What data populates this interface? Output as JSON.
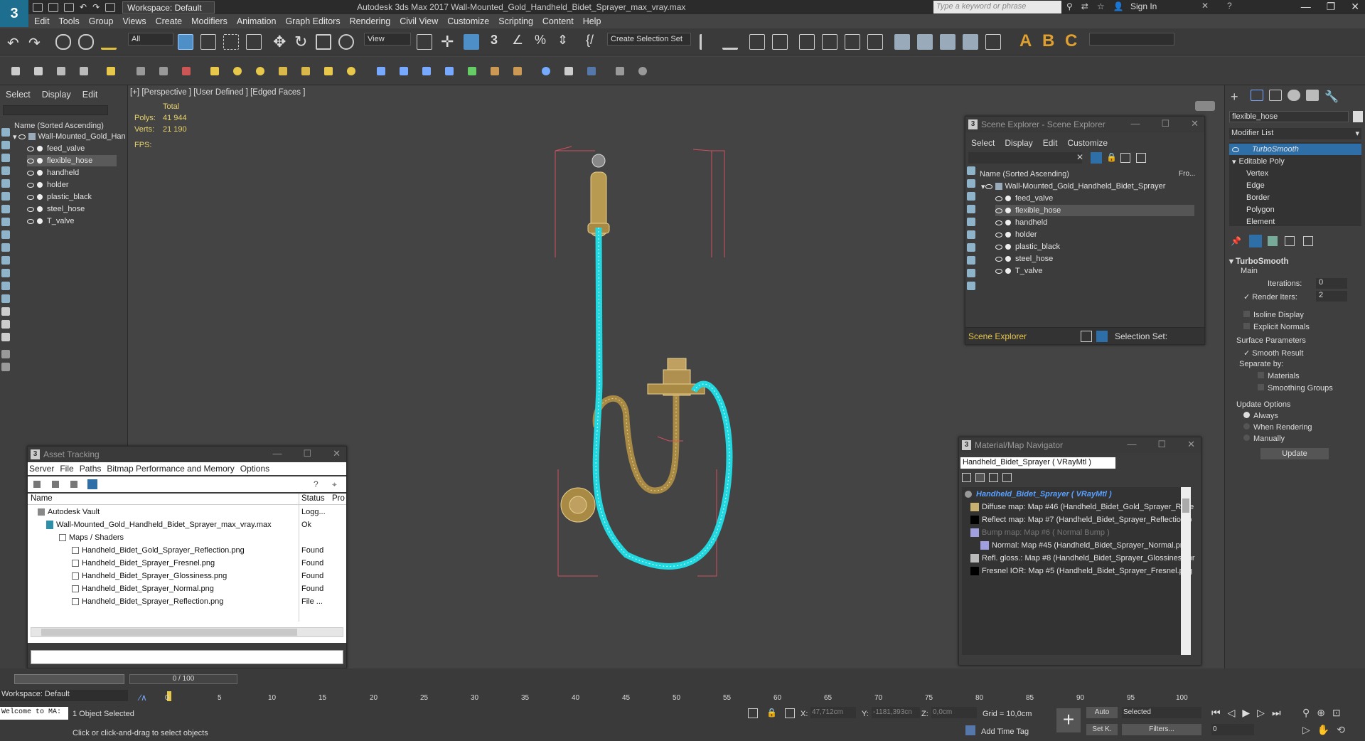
{
  "app": {
    "title": "Autodesk 3ds Max 2017     Wall-Mounted_Gold_Handheld_Bidet_Sprayer_max_vray.max",
    "logo": "3",
    "workspace": "Workspace: Default",
    "search_placeholder": "Type a keyword or phrase",
    "sign_in": "Sign In"
  },
  "menu": [
    "Edit",
    "Tools",
    "Group",
    "Views",
    "Create",
    "Modifiers",
    "Animation",
    "Graph Editors",
    "Rendering",
    "Civil View",
    "Customize",
    "Scripting",
    "Content",
    "Help"
  ],
  "toolbar": {
    "filter": "All",
    "view": "View",
    "selection_set": "Create Selection Set"
  },
  "left_panel": {
    "tabs": [
      "Select",
      "Display",
      "Edit"
    ],
    "header": "Name (Sorted Ascending)",
    "root": "Wall-Mounted_Gold_Han",
    "items": [
      "feed_valve",
      "flexible_hose",
      "handheld",
      "holder",
      "plastic_black",
      "steel_hose",
      "T_valve"
    ]
  },
  "viewport": {
    "labels": [
      "[+]",
      "[Perspective ]",
      "[User Defined ]",
      "[Edged Faces ]"
    ],
    "total": "Total",
    "polys_label": "Polys:",
    "polys": "41 944",
    "verts_label": "Verts:",
    "verts": "21 190",
    "fps": "FPS:"
  },
  "scene_explorer": {
    "title": "Scene Explorer - Scene Explorer",
    "menu": [
      "Select",
      "Display",
      "Edit",
      "Customize"
    ],
    "header": "Name (Sorted Ascending)",
    "header2": "Fro...",
    "root": "Wall-Mounted_Gold_Handheld_Bidet_Sprayer",
    "items": [
      "feed_valve",
      "flexible_hose",
      "handheld",
      "holder",
      "plastic_black",
      "steel_hose",
      "T_valve"
    ],
    "footer_label": "Scene Explorer",
    "selection_set": "Selection Set:"
  },
  "asset_tracking": {
    "title": "Asset Tracking",
    "menu": [
      "Server",
      "File",
      "Paths",
      "Bitmap Performance and Memory",
      "Options"
    ],
    "columns": [
      "Name",
      "Status",
      "Pro"
    ],
    "rows": [
      {
        "name": "Autodesk Vault",
        "status": "Logg..."
      },
      {
        "name": "Wall-Mounted_Gold_Handheld_Bidet_Sprayer_max_vray.max",
        "status": "Ok"
      },
      {
        "name": "Maps / Shaders",
        "status": ""
      },
      {
        "name": "Handheld_Bidet_Gold_Sprayer_Reflection.png",
        "status": "Found"
      },
      {
        "name": "Handheld_Bidet_Sprayer_Fresnel.png",
        "status": "Found"
      },
      {
        "name": "Handheld_Bidet_Sprayer_Glossiness.png",
        "status": "Found"
      },
      {
        "name": "Handheld_Bidet_Sprayer_Normal.png",
        "status": "Found"
      },
      {
        "name": "Handheld_Bidet_Sprayer_Reflection.png",
        "status": "File ..."
      }
    ]
  },
  "material_navigator": {
    "title": "Material/Map Navigator",
    "field": "Handheld_Bidet_Sprayer  ( VRayMtl )",
    "root": "Handheld_Bidet_Sprayer  ( VRayMtl )",
    "items": [
      "Diffuse map: Map #46 (Handheld_Bidet_Gold_Sprayer_Refle",
      "Reflect map: Map #7 (Handheld_Bidet_Sprayer_Reflection.p",
      "Bump map: Map #6  ( Normal Bump )",
      "Normal: Map #45 (Handheld_Bidet_Sprayer_Normal.png)",
      "Refl. gloss.: Map #8 (Handheld_Bidet_Sprayer_Glossiness.pr",
      "Fresnel IOR: Map #5 (Handheld_Bidet_Sprayer_Fresnel.png"
    ]
  },
  "command_panel": {
    "object_name": "flexible_hose",
    "modifier_list": "Modifier List",
    "stack": [
      "TurboSmooth",
      "Editable Poly",
      "Vertex",
      "Edge",
      "Border",
      "Polygon",
      "Element"
    ],
    "rollout": "TurboSmooth",
    "main": "Main",
    "iterations_label": "Iterations:",
    "iterations": "0",
    "render_iters_label": "Render Iters:",
    "render_iters": "2",
    "isoline": "Isoline Display",
    "explicit": "Explicit Normals",
    "surface": "Surface Parameters",
    "smooth": "Smooth Result",
    "separate": "Separate by:",
    "materials": "Materials",
    "smoothing": "Smoothing Groups",
    "update_options": "Update Options",
    "always": "Always",
    "when_rendering": "When Rendering",
    "manually": "Manually",
    "update": "Update"
  },
  "timeline": {
    "frame": "0 / 100",
    "ticks": [
      "0",
      "5",
      "10",
      "15",
      "20",
      "25",
      "30",
      "35",
      "40",
      "45",
      "50",
      "55",
      "60",
      "65",
      "70",
      "75",
      "80",
      "85",
      "90",
      "95",
      "100"
    ]
  },
  "status": {
    "workspace": "Workspace: Default",
    "welcome": "Welcome to MA:",
    "selected": "1 Object Selected",
    "prompt": "Click or click-and-drag to select objects",
    "x_label": "X:",
    "x": "47,712cm",
    "y_label": "Y:",
    "y": "-1181,393cn",
    "z_label": "Z:",
    "z": "0,0cm",
    "grid": "Grid = 10,0cm",
    "add_time_tag": "Add Time Tag",
    "auto": "Auto",
    "set_k": "Set K.",
    "selected_dd": "Selected",
    "filters": "Filters...",
    "frame_field": "0"
  },
  "colors": {
    "accent": "#2f6fa8",
    "selection": "#22d8e0",
    "stats": "#e8d36a",
    "gold": "#c8a040"
  }
}
